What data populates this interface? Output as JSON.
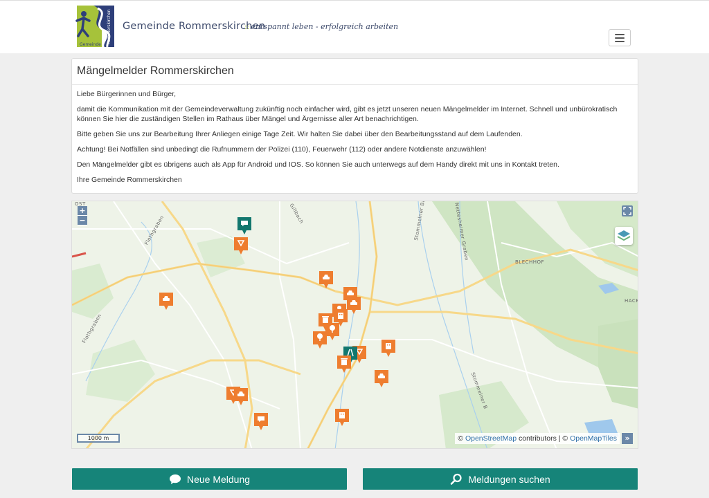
{
  "header": {
    "brand": "Gemeinde Rommerskirchen",
    "separator": "::",
    "tagline": "entspannt leben - erfolgreich arbeiten",
    "logo_text": "Rommerskirchen",
    "logo_subtext": "Gemeinde"
  },
  "card": {
    "title": "Mängelmelder Rommerskirchen",
    "paragraphs": [
      "Liebe Bürgerinnen und Bürger,",
      "damit die Kommunikation mit der Gemeindeverwaltung zukünftig noch einfacher wird, gibt es jetzt unseren neuen Mängelmelder im Internet. Schnell und unbürokratisch können Sie hier die zuständigen Stellen im Rathaus über Mängel und Ärgernisse aller Art benachrichtigen.",
      "Bitte geben Sie uns zur Bearbeitung Ihrer Anliegen einige Tage Zeit. Wir halten Sie dabei über den Bearbeitungsstand auf dem Laufenden.",
      "Achtung! Bei Notfällen sind unbedingt die Rufnummern der Polizei (110), Feuerwehr (112) oder andere Notdienste anzuwählen!",
      "Den Mängelmelder gibt es übrigens auch als App für Android und IOS. So können Sie auch unterwegs auf dem Handy direkt mit uns in Kontakt treten.",
      "Ihre Gemeinde Rommerskirchen"
    ]
  },
  "map": {
    "zoom_in": "+",
    "zoom_out": "−",
    "scale": "1000 m",
    "attribution_prefix": "©",
    "osm_link": "OpenStreetMap",
    "contributors": "contributors | ©",
    "tiles_link": "OpenMapTiles",
    "attrib_toggle": "»",
    "labels": {
      "blechhof": "BLECHHOF",
      "hackh": "HACK",
      "ost": "OST",
      "gillbach": "Gillbach",
      "flothgraben_1": "Flothgraben",
      "flothgraben_2": "Flothgraben",
      "stommelner_bach": "Stommelner Bach",
      "nettesheimer_graben": "Nettesheimer Graben",
      "stommelner_b": "Stommelner B"
    },
    "pins": [
      {
        "type": "chat",
        "status": "done"
      },
      {
        "type": "sign"
      },
      {
        "type": "car"
      },
      {
        "type": "car"
      },
      {
        "type": "car"
      },
      {
        "type": "car"
      },
      {
        "type": "lamp"
      },
      {
        "type": "trash"
      },
      {
        "type": "tree"
      },
      {
        "type": "tree"
      },
      {
        "type": "building"
      },
      {
        "type": "building"
      },
      {
        "type": "sign"
      },
      {
        "type": "road",
        "status": "done"
      },
      {
        "type": "trash"
      },
      {
        "type": "car"
      },
      {
        "type": "sign"
      },
      {
        "type": "car"
      },
      {
        "type": "chat"
      },
      {
        "type": "building"
      }
    ],
    "colors": {
      "open": "#ee7d2f",
      "done": "#12776e"
    }
  },
  "buttons": {
    "new_report": "Neue Meldung",
    "search_reports": "Meldungen suchen"
  },
  "colors": {
    "accent": "#168479",
    "brand_text": "#3d4a6b"
  }
}
